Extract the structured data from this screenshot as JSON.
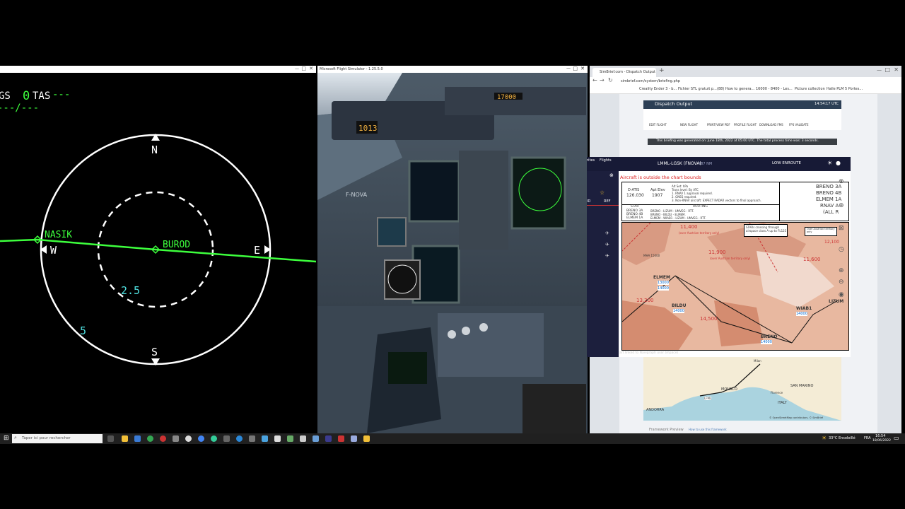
{
  "nd": {
    "gs_label": "GS",
    "gs_value": "0",
    "tas_label": "TAS",
    "tas_value": "---",
    "wind": "---/---",
    "north": "N",
    "south": "S",
    "east": "E",
    "west": "W",
    "range_inner": "2.5",
    "range_outer": "5",
    "wpt1": "NASIK",
    "wpt2": "BUROD"
  },
  "msfs": {
    "title": "Microsoft Flight Simulator - 1.25.5.0",
    "airplane_reg": "F-NOVA",
    "fcu_value": "1013",
    "fcu_alt": "17000"
  },
  "browser": {
    "tab1": "SimBrief.com - Dispatch Output",
    "url": "simbrief.com/system/briefing.php",
    "bookmarks": [
      "Creality Ender 3 - b...",
      "Fichier STL gratuit p...",
      "(88) How to genera...",
      "16000 - 8400 - Les...",
      "Picture collection",
      "Halle PLM 5 Portes..."
    ],
    "dispatch_title": "Dispatch Output",
    "dispatch_time": "14:54:17 UTC",
    "dispatch_buttons": [
      "EDIT FLIGHT",
      "NEW FLIGHT",
      "PRINT/VIEW PDF",
      "PROFILE FLIGHT",
      "DOWNLOAD FMS",
      "FPS VALIDATE"
    ],
    "briefing_note": "This briefing was generated on: June 18th, 2022 at 05:00 UTC.   The total process time was: 3 seconds.",
    "map_labels": {
      "andorra": "ANDORRA",
      "monaco": "MONACO",
      "san_marino": "SAN MARINO",
      "italy": "ITALY",
      "florence": "Florence",
      "milan": "Milan",
      "credit": "© OpenStreetMap contributors, © SimBrief",
      "lfml": "LFML"
    },
    "footer": "Framework Preview",
    "footer_link": "How to use this framework"
  },
  "navigraph": {
    "route": "LMML-LGSK (FNOVA)",
    "distance": "487 NM",
    "mode": "LOW ENROUTE",
    "warning": "Aircraft is outside the chart bounds",
    "tab_id": "ID",
    "tab_ref": "REF",
    "side_labels": [
      "rites",
      "Flights"
    ],
    "chart_freq_label": "D-ATIS",
    "chart_freq": "126.030",
    "apt_elev_label": "Apt Elev",
    "apt_elev": "1907",
    "notes": [
      "Alt Set: hPa",
      "Trans level: By ATC",
      "1. RNAV 1 approval required.",
      "2. GNSS required.",
      "3. Non-RNAV aircraft: EXPECT RADAR vectors to final approach."
    ],
    "star_header": "STAR",
    "routing_header": "ROUTING",
    "star_rows": [
      {
        "star": "BRENO 3A",
        "route": "BRENO - LIZUM - UMVEG - RTT."
      },
      {
        "star": "BRENO 4B",
        "route": "BRENO - BILDU - ELMEM."
      },
      {
        "star": "ELMEM 1A",
        "route": "ELMEM - WIAB1 - LIZUM - UMVEG - RTT."
      }
    ],
    "right_labels": [
      "BRENO 3A",
      "BRENO 4B",
      "ELMEM 1A",
      "RNAV A",
      "(ALL R"
    ],
    "star_note": "STARs crossing through airspace class A up to FL125",
    "over_austrian": "Over Austrian territory only",
    "chart_alts": [
      "11,400",
      "11,900",
      "11,600",
      "14,500",
      "13,200",
      "12,100"
    ],
    "over_austrian_short": "(over Austrian territory only)",
    "fixes": [
      "ELMEM",
      "BILDU",
      "BRENO",
      "WIAB1",
      "LIZUM"
    ],
    "fix_alts": [
      "13000",
      "14000",
      "14000",
      "14000",
      "14000"
    ],
    "msa": "MHA 15000",
    "footer": "art linked to Navigraph user (mpace)"
  },
  "taskbar": {
    "search_placeholder": "Taper ici pour rechercher",
    "weather": "33°C  Ensoleillé",
    "lang": "FRA",
    "time": "16:54",
    "date": "18/06/2022"
  }
}
